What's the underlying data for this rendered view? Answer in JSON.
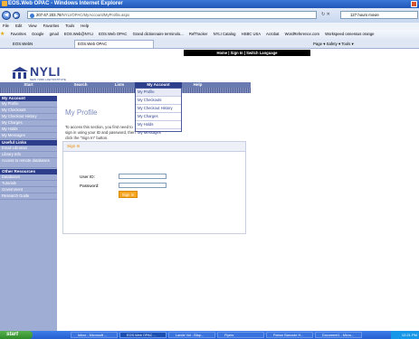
{
  "window": {
    "title": "EOS.Web OPAC - Windows Internet Explorer"
  },
  "browser": {
    "url_host": "207.67.203.78",
    "url_rest": "/NYLI/OPAC/MyAccount/MyProfile.aspx",
    "search_text": "127 hours movie",
    "menu": [
      "File",
      "Edit",
      "View",
      "Favorites",
      "Tools",
      "Help"
    ],
    "favorites": [
      "Favorites",
      "Google",
      "gmail",
      "EOS.Web@NYLI",
      "EOS.Web OPAC",
      "Grand dictionnaire terminolo...",
      "RefTracker",
      "NYLI Catalog",
      "HSBC USA",
      "Acrobat",
      "WordReference.com",
      "Workspeed onnessus orange"
    ],
    "tabs": [
      "EOS.WebN",
      "EOS.Web OPAC"
    ],
    "command_bar": "Page ▾  Safety ▾  Tools ▾"
  },
  "page": {
    "top_links": [
      "Home",
      "Sign In",
      "Switch Language"
    ],
    "logo": {
      "name": "NYLI",
      "tagline": "NEW YORK LAW INSTITUTE"
    },
    "nav": [
      "Start",
      "Search",
      "Lists",
      "My Account",
      "Help"
    ],
    "dropdown": [
      "My Profile",
      "My Checkouts",
      "My Checkout History",
      "My Charges",
      "My Holds",
      "My Messages"
    ],
    "sidebar": {
      "sections": [
        {
          "title": "My Account",
          "items": [
            "My Profile",
            "My Checkouts",
            "My Checkout History",
            "My Charges",
            "My Holds",
            "My Messages"
          ]
        },
        {
          "title": "Useful Links",
          "items": [
            "Email Librarian",
            "Library Info",
            "Access to remote databases"
          ]
        },
        {
          "title": "Other Resources",
          "items": [
            "Databases",
            "Tutorials",
            "Government",
            "Research Guide"
          ]
        }
      ]
    },
    "title": "My Profile",
    "instructions": "To access this section, you first need to sign in using your ID and password, then click the \"Sign In\" button.",
    "signin": {
      "header": "Sign In",
      "user_label": "User ID:",
      "password_label": "Password:",
      "button": "Sign In"
    }
  },
  "taskbar": {
    "start": "start",
    "tasks": [
      "Inbox - Microsoft ...",
      "EOS.Web OPAC ...",
      "Lande Vol - Blap...",
      "Flyers",
      "Patron Barcode H...",
      "Document1 - Micro..."
    ],
    "clock": "12:21 PM"
  }
}
